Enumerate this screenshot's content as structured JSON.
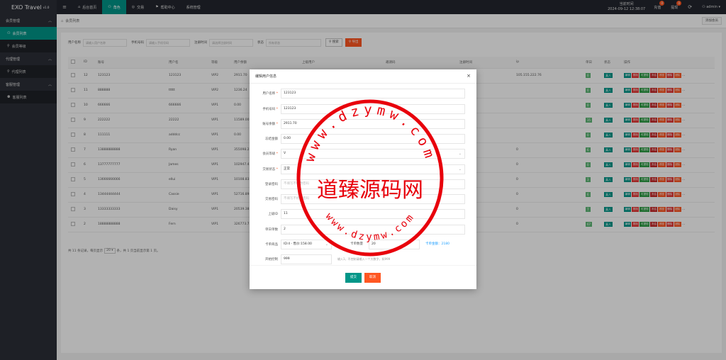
{
  "app": {
    "title": "EXO Travel",
    "version": "v1.0"
  },
  "topnav": {
    "menu_icon": "≡",
    "items": [
      {
        "label": "后台首页",
        "icon": "⌂",
        "active": false
      },
      {
        "label": "角色",
        "icon": "⚇",
        "active": true
      },
      {
        "label": "交易",
        "icon": "◎",
        "active": false
      },
      {
        "label": "帮助中心",
        "icon": "⚑",
        "active": false
      },
      {
        "label": "系统管理",
        "icon": "",
        "active": false
      }
    ]
  },
  "topright": {
    "clock_label": "当前时间",
    "clock_value": "2024-09-12 12:38:07",
    "recharge_label": "充值",
    "recharge_count": "0",
    "withdraw_label": "提现",
    "withdraw_count": "0",
    "refresh_icon": "⟳",
    "user_label": "admin"
  },
  "sidebar": [
    {
      "type": "group",
      "label": "会员管理"
    },
    {
      "type": "item",
      "label": "会员列表",
      "icon": "⚇",
      "active": true
    },
    {
      "type": "item",
      "label": "会员等级",
      "icon": "⚲",
      "active": false
    },
    {
      "type": "group",
      "label": "代理管理"
    },
    {
      "type": "item",
      "label": "代理列表",
      "icon": "⚲",
      "active": false
    },
    {
      "type": "group",
      "label": "客服管理"
    },
    {
      "type": "item",
      "label": "客服列表",
      "icon": "⚉",
      "active": false
    }
  ],
  "breadcrumb": {
    "home_icon": "⌂",
    "label": "会员列表",
    "add_button": "添加会员"
  },
  "filters": {
    "username_label": "用户名称",
    "username_placeholder": "请输入用户名称",
    "phone_label": "手机号码",
    "phone_placeholder": "请输入手机号码",
    "regtime_label": "注册时间",
    "regtime_placeholder": "请选择注册时间",
    "status_label": "状态",
    "status_placeholder": "所有状态",
    "search_button": "搜索",
    "export_button": "导出"
  },
  "table": {
    "headers": [
      "",
      "ID",
      "账号",
      "用户名",
      "等级",
      "用户余额",
      "上级用户",
      "邀请码",
      "注册时间",
      "ip",
      "单日",
      "状态",
      "操作"
    ],
    "actions": [
      "编辑",
      "禁用",
      "可提现",
      "冻结",
      "改密",
      "删除",
      "团队",
      "…"
    ],
    "rows": [
      {
        "id": "12",
        "account": "123123",
        "name": "123123",
        "level": "VIP2",
        "balance": "2911.70",
        "time": "24:04",
        "ip": "105.155.222.76",
        "daily": "0"
      },
      {
        "id": "11",
        "account": "888888",
        "name": "ttttt",
        "level": "VIP2",
        "balance": "1236.24",
        "time": "28:11",
        "ip": "",
        "daily": "0"
      },
      {
        "id": "10",
        "account": "666666",
        "name": "666666",
        "level": "VIP1",
        "balance": "0.00",
        "time": "42:32",
        "ip": "",
        "daily": "0"
      },
      {
        "id": "9",
        "account": "222222",
        "name": "22222",
        "level": "VIP1",
        "balance": "11589.00",
        "time": "76:41",
        "ip": "",
        "daily": "35"
      },
      {
        "id": "8",
        "account": "111111",
        "name": "adddcc",
        "level": "VIP1",
        "balance": "0.00",
        "time": "15:09",
        "ip": "",
        "daily": "0"
      },
      {
        "id": "7",
        "account": "13888888888",
        "name": "Ryan",
        "level": "VIP1",
        "balance": "355098.22",
        "time": "25:13",
        "ip": "0",
        "daily": "6"
      },
      {
        "id": "6",
        "account": "13777777777",
        "name": "James",
        "level": "VIP1",
        "balance": "102947.41",
        "time": "25:03",
        "ip": "0",
        "daily": "0"
      },
      {
        "id": "5",
        "account": "13666666666",
        "name": "ellui",
        "level": "VIP1",
        "balance": "10108.83",
        "time": "59:52",
        "ip": "0",
        "daily": "3"
      },
      {
        "id": "4",
        "account": "13444444444",
        "name": "Cassie",
        "level": "VIP1",
        "balance": "52716.89",
        "time": "55:02",
        "ip": "0",
        "daily": "6"
      },
      {
        "id": "3",
        "account": "13333333333",
        "name": "Daisy",
        "level": "VIP1",
        "balance": "20539.38",
        "time": "50:29",
        "ip": "0",
        "daily": "7"
      },
      {
        "id": "2",
        "account": "18888888888",
        "name": "Fern",
        "level": "VIP1",
        "balance": "326773.73",
        "time": "26:38",
        "ip": "0",
        "daily": "67"
      }
    ],
    "status_label": "真人"
  },
  "pager": {
    "prefix": "共 11 条记录，每页显示",
    "page_size": "20",
    "suffix": "条，共 1 页当前显示第 1 页。"
  },
  "modal": {
    "title": "编辑用户信息",
    "close_icon": "×",
    "fields": {
      "username_label": "用户名称",
      "username_value": "123123",
      "phone_label": "手机号码",
      "phone_value": "123123",
      "balance_label": "账号余额",
      "balance_value": "2911.70",
      "frozen_label": "冻结金额",
      "frozen_value": "0.00",
      "level_label": "会员等级",
      "level_value": "V",
      "status_label": "交易状态",
      "status_value": "正常",
      "login_pwd_label": "登录密码",
      "login_pwd_placeholder": "不填写不修改密码",
      "trade_pwd_label": "交易密码",
      "trade_pwd_placeholder": "不填写不修改密码",
      "parent_label": "上级ID",
      "parent_value": "11",
      "daily_label": "单日单数",
      "daily_value": "2",
      "card_label": "卡单商品",
      "card_value": "ID:4 - 售价:158.00",
      "card_qty_label": "卡单数量",
      "card_qty_value": "20",
      "card_total": "卡单金额：2180",
      "switch_label": "开始控制",
      "switch_value": "999",
      "switch_hint": "输入1，不控制请输入一个大数字，如999"
    },
    "submit_button": "提交",
    "cancel_button": "取消"
  },
  "watermark": {
    "text": "道臻源码网",
    "ring_text": "www.dzymw.com"
  },
  "colors": {
    "accent": "#009688",
    "danger": "#ff5722",
    "dark": "#23262e",
    "seal": "#e8000b"
  }
}
